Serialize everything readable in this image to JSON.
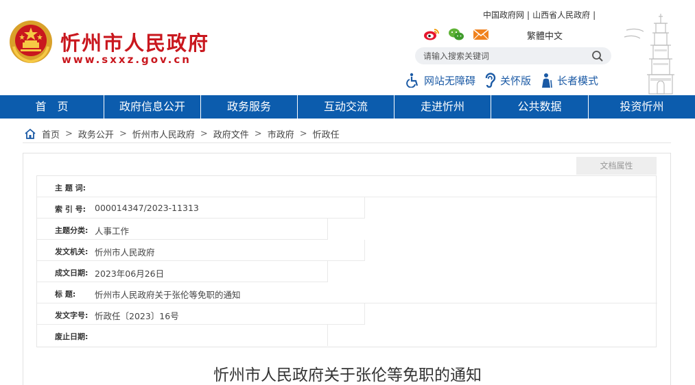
{
  "header": {
    "title": "忻州市人民政府",
    "url": "www.sxxz.gov.cn",
    "top_links": [
      "中国政府网",
      "山西省人民政府"
    ],
    "social": [
      "weibo-icon",
      "wechat-icon",
      "mail-icon"
    ],
    "traditional_label": "繁體中文",
    "search": {
      "placeholder": "请输入搜索关键词"
    },
    "accessibility": [
      {
        "label": "网站无障碍",
        "icon": "wheelchair-icon"
      },
      {
        "label": "关怀版",
        "icon": "ear-icon"
      },
      {
        "label": "长者模式",
        "icon": "elder-icon"
      }
    ]
  },
  "nav": {
    "items": [
      "首　页",
      "政府信息公开",
      "政务服务",
      "互动交流",
      "走进忻州",
      "公共数据",
      "投资忻州"
    ]
  },
  "breadcrumb": {
    "items": [
      "首页",
      "政务公开",
      "忻州市人民政府",
      "政府文件",
      "市政府",
      "忻政任"
    ],
    "home_icon": "home-icon"
  },
  "doc_attr_tab": "文档属性",
  "meta": [
    {
      "label": "主  题  词:",
      "value": ""
    },
    {
      "label": "索  引  号:",
      "value": "000014347/2023-11313"
    },
    {
      "label": "主题分类:",
      "value": "人事工作"
    },
    {
      "label": "发文机关:",
      "value": "忻州市人民政府"
    },
    {
      "label": "成文日期:",
      "value": "2023年06月26日"
    },
    {
      "label": "标       题:",
      "value": "忻州市人民政府关于张伦等免职的通知"
    },
    {
      "label": "发文字号:",
      "value": "忻政任〔2023〕16号"
    },
    {
      "label": "废止日期:",
      "value": ""
    }
  ],
  "doc_title": "忻州市人民政府关于张伦等免职的通知",
  "colors": {
    "brand_red": "#c9171e",
    "nav_blue": "#0c5cad",
    "link_blue": "#1b5aa5"
  }
}
